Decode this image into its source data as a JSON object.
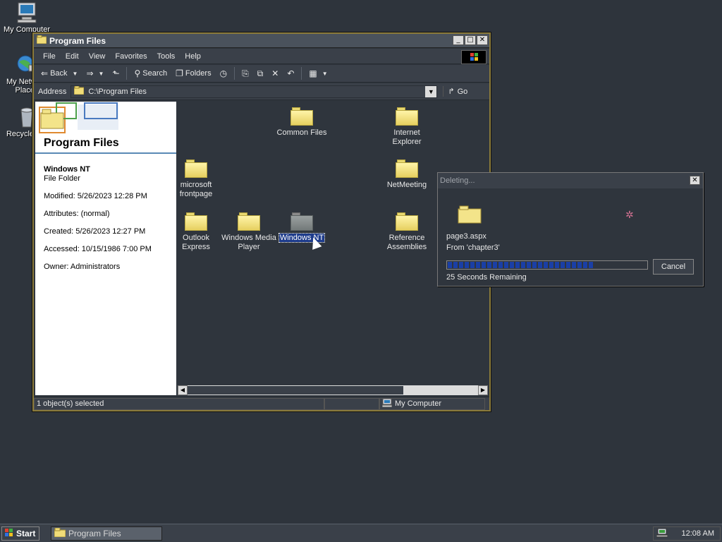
{
  "desktop": {
    "icons": [
      {
        "label": "My Computer",
        "icon": "monitor-icon"
      },
      {
        "label": "My Network Places",
        "icon": "network-globe-icon"
      },
      {
        "label": "Recycle Bin",
        "icon": "recycle-bin-icon"
      }
    ]
  },
  "window": {
    "title": "Program Files",
    "menu": [
      "File",
      "Edit",
      "View",
      "Favorites",
      "Tools",
      "Help"
    ],
    "toolbar": {
      "back": "Back",
      "search": "Search",
      "folders": "Folders"
    },
    "address": {
      "label": "Address",
      "value": "C:\\Program Files",
      "go": "Go"
    },
    "info_pane": {
      "title": "Program Files",
      "selected_name": "Windows NT",
      "selected_type": "File Folder",
      "modified": "Modified: 5/26/2023 12:28 PM",
      "attributes": "Attributes: (normal)",
      "created": "Created: 5/26/2023 12:27 PM",
      "accessed": "Accessed: 10/15/1986 7:00 PM",
      "owner": "Owner: Administrators"
    },
    "files": [
      {
        "name": "Common Files",
        "icon": "folder-icon"
      },
      {
        "name": "Internet Explorer",
        "icon": "folder-icon"
      },
      {
        "name": "microsoft frontpage",
        "icon": "folder-icon"
      },
      {
        "name": "NetMeeting",
        "icon": "folder-icon"
      },
      {
        "name": "Outlook Express",
        "icon": "folder-icon"
      },
      {
        "name": "Windows Media Player",
        "icon": "folder-icon"
      },
      {
        "name": "Windows NT",
        "icon": "folder-icon",
        "selected": true
      },
      {
        "name": "Reference Assemblies",
        "icon": "folder-icon"
      }
    ],
    "status": {
      "selection": "1 object(s) selected",
      "zone": "My Computer"
    }
  },
  "dialog": {
    "title": "Deleting...",
    "file": "page3.aspx",
    "from": "From 'chapter3'",
    "remaining": "25 Seconds Remaining",
    "progress": 0.73,
    "cancel": "Cancel"
  },
  "taskbar": {
    "start": "Start",
    "task": "Program Files",
    "clock": "12:08 AM"
  },
  "colors": {
    "desktop": "#2e343c",
    "progress_fill": "#1a3fa6",
    "selection": "#1e3c8c"
  }
}
